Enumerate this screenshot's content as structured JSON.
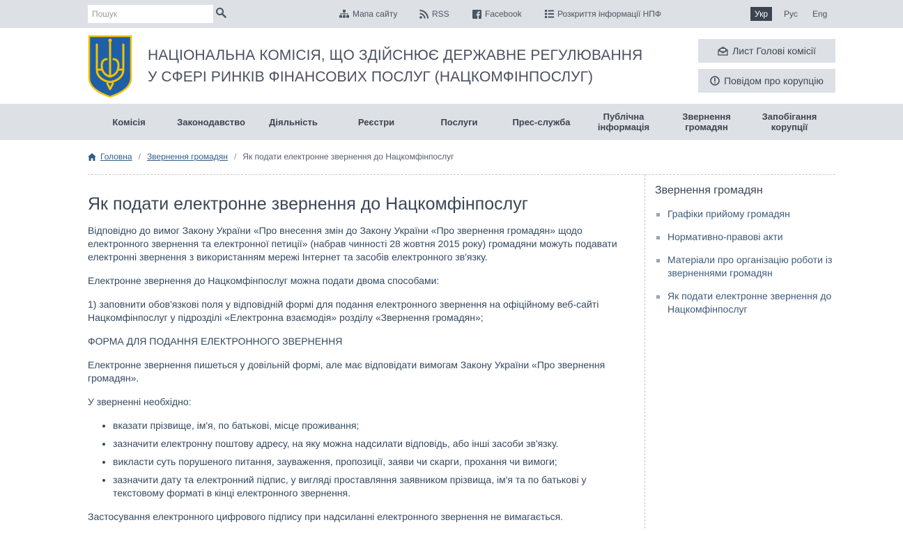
{
  "topbar": {
    "search_placeholder": "Пошук",
    "links": {
      "sitemap": "Мапа сайту",
      "rss": "RSS",
      "facebook": "Facebook",
      "disclosure": "Розкриття інформації НПФ"
    },
    "languages": [
      "Укр",
      "Рус",
      "Eng"
    ],
    "active_language": "Укр"
  },
  "header": {
    "title_line1": "НАЦІОНАЛЬНА КОМІСІЯ, ЩО ЗДІЙСНЮЄ ДЕРЖАВНЕ РЕГУЛЮВАННЯ",
    "title_line2": "У СФЕРІ РИНКІВ ФІНАНСОВИХ ПОСЛУГ (НАЦКОМФІНПОСЛУГ)",
    "letter_button": "Лист Голові комісії",
    "corruption_button": "Повідом про корупцію"
  },
  "nav": {
    "items": [
      "Комісія",
      "Законодавство",
      "Діяльність",
      "Реєстри",
      "Послуги",
      "Прес-служба"
    ],
    "multiline": [
      {
        "line1": "Публічна",
        "line2": "інформація"
      },
      {
        "line1": "Звернення",
        "line2": "громадян"
      },
      {
        "line1": "Запобігання",
        "line2": "корупції"
      }
    ]
  },
  "breadcrumb": {
    "home": "Головна",
    "section": "Звернення громадян",
    "current": "Як подати електронне звернення до Нацкомфінпослуг"
  },
  "article": {
    "title": "Як подати електронне звернення до Нацкомфінпослуг",
    "p1": "Відповідно до вимог Закону України «Про внесення змін до Закону України «Про звернення громадян» щодо електронного звернення та електронної петиції» (набрав чинності 28 жовтня 2015 року) громадяни можуть подавати електронні звернення з використанням мережі Інтернет та засобів електронного зв'язку.",
    "p2": "Електронне звернення до Нацкомфінпослуг можна подати двома способами:",
    "p3": "1) заповнити обов'язкові поля у відповідній формі для подання електронного звернення на офіційному веб-сайті Нацкомфінпослуг у підрозділі «Електронна взаємодія» розділу «Звернення громадян»;",
    "form_link": "ФОРМА ДЛЯ ПОДАННЯ ЕЛЕКТРОННОГО ЗВЕРНЕННЯ",
    "p4": "Електронне звернення пишеться у довільній формі, але має відповідати вимогам Закону України «Про звернення громадян».",
    "p5": "У зверненні необхідно:",
    "list": [
      "вказати прізвище, ім'я, по батькові, місце проживання;",
      "зазначити електронну поштову адресу, на яку можна надсилати відповідь, або інші засоби зв'язку.",
      "викласти суть порушеного питання, зауваження, пропозиції, заяви чи скарги, прохання чи вимоги;",
      "зазначити дату та електронний підпис, у вигляді проставляння заявником прізвища, ім'я та по батькові у текстовому форматі в кінці електронного звернення."
    ],
    "p6": "Застосування електронного цифрового підпису при надсиланні електронного звернення не вимагається."
  },
  "sidebar": {
    "title": "Звернення громадян",
    "items": [
      "Графіки прийому громадян",
      "Нормативно-правові акти",
      "Матеріали про організацію роботи із зверненнями громадян",
      "Як подати електронне звернення до Нацкомфінпослуг"
    ]
  },
  "colors": {
    "bar_bg": "#dde0e4",
    "text": "#34495e",
    "link": "#2f5d88",
    "emblem_blue": "#1f5fa8",
    "emblem_gold": "#f2c200"
  },
  "icons": [
    "search-icon",
    "sitemap-icon",
    "rss-icon",
    "facebook-icon",
    "list-icon",
    "envelope-icon",
    "alert-circle-icon",
    "home-icon",
    "trident-emblem"
  ]
}
